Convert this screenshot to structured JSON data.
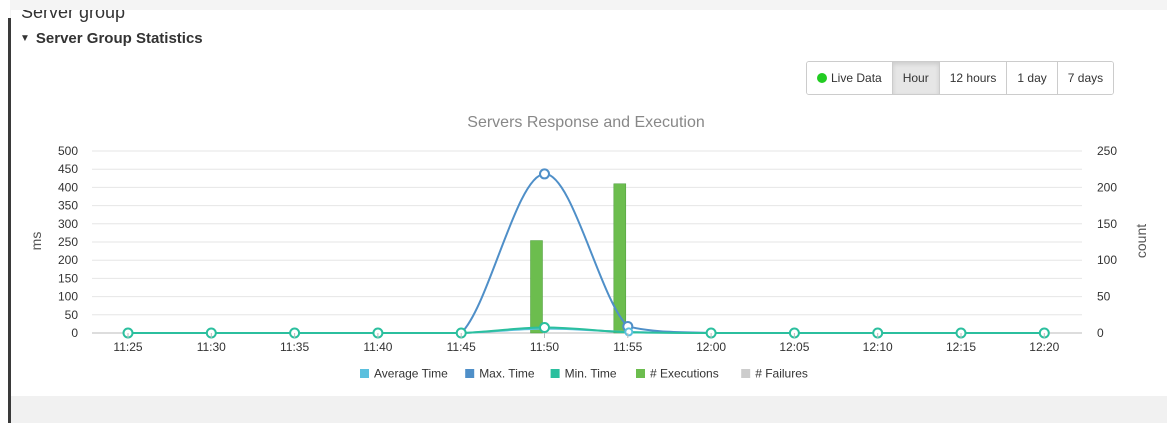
{
  "page": {
    "cut_title": "Server group",
    "section_title": "Server Group Statistics",
    "caret_icon": "caret-down-icon"
  },
  "range_buttons": {
    "live": "Live Data",
    "hour": "Hour",
    "h12": "12 hours",
    "d1": "1 day",
    "d7": "7 days",
    "active": "Hour",
    "live_color": "#22cc22"
  },
  "chart_data": {
    "type": "line",
    "title": "Servers Response and Execution",
    "ylabel": "ms",
    "y2label": "count",
    "ylim": [
      0,
      500
    ],
    "y2lim": [
      0,
      250
    ],
    "yticks": [
      0,
      50,
      100,
      150,
      200,
      250,
      300,
      350,
      400,
      450,
      500
    ],
    "y2ticks": [
      0,
      50,
      100,
      150,
      200,
      250
    ],
    "categories": [
      "11:25",
      "11:30",
      "11:35",
      "11:40",
      "11:45",
      "11:50",
      "11:55",
      "12:00",
      "12:05",
      "12:10",
      "12:15",
      "12:20"
    ],
    "grid": true,
    "legend_position": "bottom",
    "series": [
      {
        "name": "Average Time",
        "axis": "left",
        "kind": "line",
        "color": "#5bc0de",
        "values": [
          0,
          0,
          0,
          0,
          0,
          12,
          3,
          0,
          0,
          0,
          0,
          0
        ]
      },
      {
        "name": "Max. Time",
        "axis": "left",
        "kind": "line",
        "color": "#4f8fc8",
        "values": [
          0,
          0,
          0,
          0,
          0,
          437,
          18,
          0,
          0,
          0,
          0,
          0
        ]
      },
      {
        "name": "Min. Time",
        "axis": "left",
        "kind": "line",
        "color": "#2bbf9e",
        "values": [
          0,
          0,
          0,
          0,
          0,
          15,
          2,
          0,
          0,
          0,
          0,
          0
        ]
      },
      {
        "name": "# Executions",
        "axis": "right",
        "kind": "bar",
        "color": "#6cbd4e",
        "values": [
          0,
          0,
          0,
          0,
          0,
          127,
          205,
          0,
          0,
          0,
          0,
          0
        ]
      },
      {
        "name": "# Failures",
        "axis": "right",
        "kind": "bar",
        "color": "#cccccc",
        "values": [
          0,
          0,
          0,
          0,
          0,
          0,
          0,
          0,
          0,
          0,
          0,
          0
        ]
      }
    ]
  }
}
